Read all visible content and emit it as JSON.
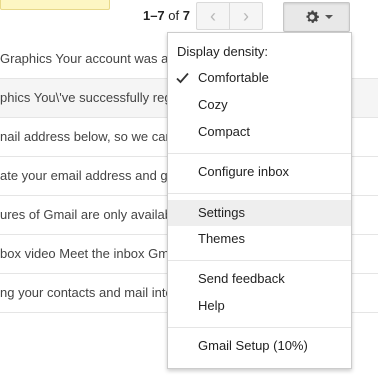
{
  "pager": {
    "range": "1–7",
    "of": "of",
    "total": "7"
  },
  "emails": [
    {
      "snippet": "Graphics Your account was ac",
      "shaded": false
    },
    {
      "snippet": "phics You\\'ve successfully reg",
      "shaded": true
    },
    {
      "snippet": "nail address below, so we can",
      "shaded": false
    },
    {
      "snippet": "ate your email address and ge",
      "shaded": false
    },
    {
      "snippet": "ures of Gmail are only availab",
      "shaded": false
    },
    {
      "snippet": "box video Meet the inbox Gma",
      "shaded": false
    },
    {
      "snippet": "ng your contacts and mail into",
      "shaded": false
    }
  ],
  "menu": {
    "density_header": "Display density:",
    "comfortable": "Comfortable",
    "cozy": "Cozy",
    "compact": "Compact",
    "configure_inbox": "Configure inbox",
    "settings": "Settings",
    "themes": "Themes",
    "send_feedback": "Send feedback",
    "help": "Help",
    "gmail_setup": "Gmail Setup (10%)",
    "selected_density": "Comfortable",
    "hovered_item": "Settings"
  },
  "icons": {
    "prev": "chevron-left-icon",
    "next": "chevron-right-icon",
    "settings": "gear-icon",
    "dropdown": "caret-down-icon",
    "checked": "checkmark-icon"
  },
  "colors": {
    "menu_hover": "#eeeeee",
    "row_shaded": "#f5f5f5",
    "tooltip_bg": "#fdf6c3"
  }
}
